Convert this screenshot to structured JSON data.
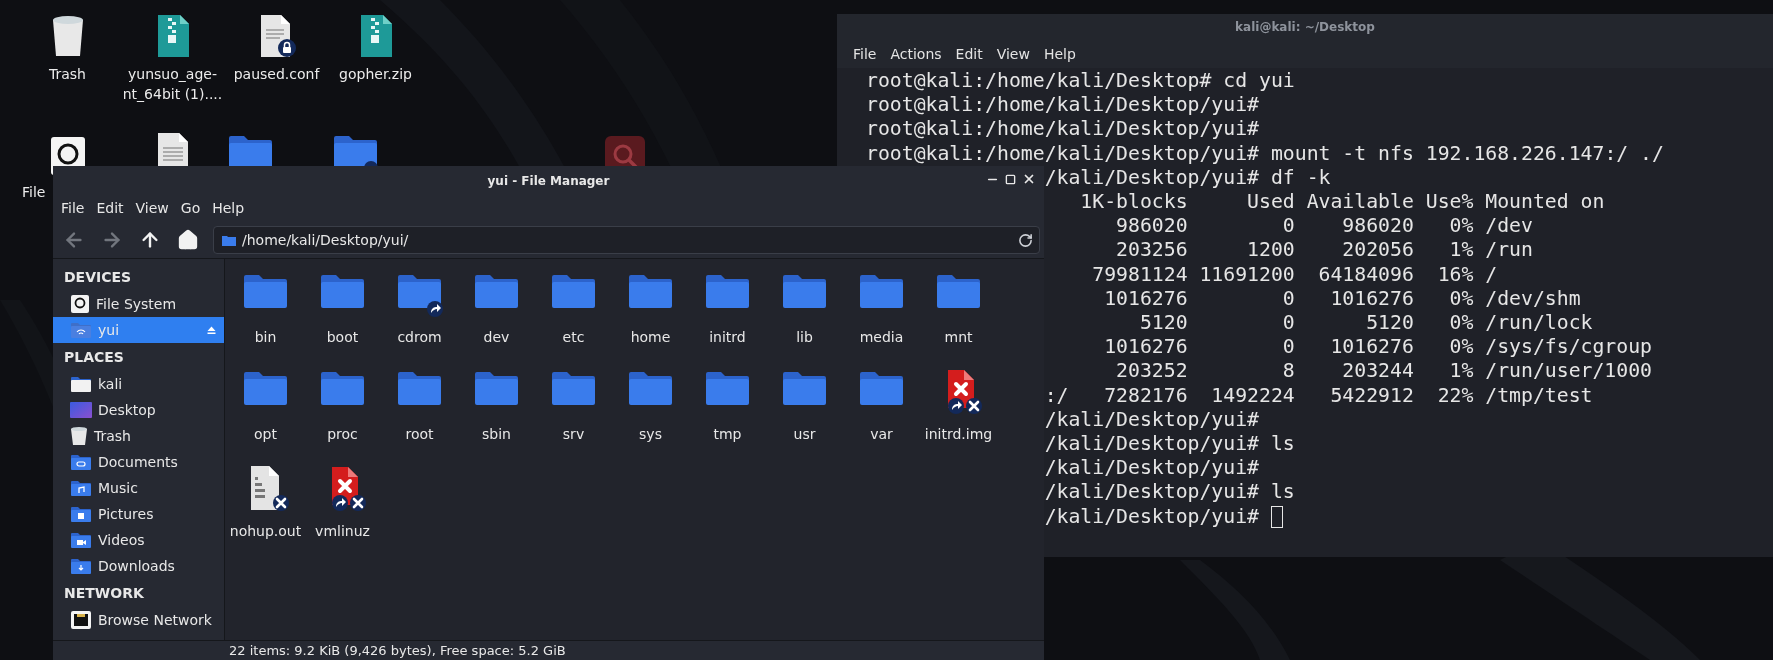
{
  "desktop": {
    "icons": [
      {
        "kind": "trash",
        "label_lines": [
          "Trash"
        ]
      },
      {
        "kind": "archive",
        "label_lines": [
          "yunsuo_age-",
          "nt_64bit (1)...."
        ]
      },
      {
        "kind": "locked-text-file",
        "label_lines": [
          "paused.conf"
        ]
      },
      {
        "kind": "archive",
        "label_lines": [
          "gopher.zip"
        ]
      },
      {
        "kind": "drive",
        "label_lines": [
          "File"
        ]
      },
      {
        "kind": "text-file"
      },
      {
        "kind": "folder"
      },
      {
        "kind": "shared-folder"
      },
      {
        "kind": "search-app"
      }
    ]
  },
  "terminal": {
    "title": "kali@kali: ~/Desktop",
    "menu": [
      "File",
      "Actions",
      "Edit",
      "View",
      "Help"
    ],
    "cursor": true,
    "lines": [
      {
        "text": "root@kali:/home/kali/Desktop# cd yui",
        "clipped": false
      },
      {
        "text": "root@kali:/home/kali/Desktop/yui#",
        "clipped": false
      },
      {
        "text": "root@kali:/home/kali/Desktop/yui#",
        "clipped": false
      },
      {
        "text": "root@kali:/home/kali/Desktop/yui# mount -t nfs 192.168.226.147:/ ./",
        "clipped": false
      },
      {
        "text": "/kali/Desktop/yui# df -k",
        "clipped": true
      },
      {
        "text": "   1K-blocks     Used Available Use% Mounted on",
        "clipped": true
      },
      {
        "text": "      986020        0    986020   0% /dev",
        "clipped": true
      },
      {
        "text": "      203256     1200    202056   1% /run",
        "clipped": true
      },
      {
        "text": "    79981124 11691200  64184096  16% /",
        "clipped": true
      },
      {
        "text": "     1016276        0   1016276   0% /dev/shm",
        "clipped": true
      },
      {
        "text": "        5120        0      5120   0% /run/lock",
        "clipped": true
      },
      {
        "text": "     1016276        0   1016276   0% /sys/fs/cgroup",
        "clipped": true
      },
      {
        "text": "      203252        8    203244   1% /run/user/1000",
        "clipped": true
      },
      {
        "text": ":/   7282176  1492224   5422912  22% /tmp/test",
        "clipped": true
      },
      {
        "text": "/kali/Desktop/yui#",
        "clipped": true
      },
      {
        "text": "/kali/Desktop/yui# ls",
        "clipped": true
      },
      {
        "text": "/kali/Desktop/yui#",
        "clipped": true
      },
      {
        "text": "/kali/Desktop/yui# ls",
        "clipped": true
      },
      {
        "text": "/kali/Desktop/yui# ",
        "clipped": true
      }
    ]
  },
  "file_manager": {
    "title": "yui - File Manager",
    "menu": [
      "File",
      "Edit",
      "View",
      "Go",
      "Help"
    ],
    "toolbar": [
      {
        "kind": "back",
        "disabled": true
      },
      {
        "kind": "forward",
        "disabled": true
      },
      {
        "kind": "up",
        "disabled": false
      },
      {
        "kind": "home",
        "disabled": false
      }
    ],
    "location": "/home/kali/Desktop/yui/",
    "sidebar": [
      {
        "title": "DEVICES",
        "items": [
          {
            "label": "File System",
            "kind": "drive",
            "selected": false,
            "ejectable": false
          },
          {
            "label": "yui",
            "kind": "network-folder",
            "selected": true,
            "ejectable": true
          }
        ]
      },
      {
        "title": "PLACES",
        "items": [
          {
            "label": "kali",
            "kind": "home",
            "selected": false,
            "ejectable": false
          },
          {
            "label": "Desktop",
            "kind": "desktop",
            "selected": false,
            "ejectable": false
          },
          {
            "label": "Trash",
            "kind": "trash",
            "selected": false,
            "ejectable": false
          },
          {
            "label": "Documents",
            "kind": "documents",
            "selected": false,
            "ejectable": false
          },
          {
            "label": "Music",
            "kind": "music",
            "selected": false,
            "ejectable": false
          },
          {
            "label": "Pictures",
            "kind": "pictures",
            "selected": false,
            "ejectable": false
          },
          {
            "label": "Videos",
            "kind": "videos",
            "selected": false,
            "ejectable": false
          },
          {
            "label": "Downloads",
            "kind": "downloads",
            "selected": false,
            "ejectable": false
          }
        ]
      },
      {
        "title": "NETWORK",
        "items": [
          {
            "label": "Browse Network",
            "kind": "network",
            "selected": false,
            "ejectable": false
          }
        ]
      }
    ],
    "items": [
      {
        "name": "bin",
        "kind": "folder",
        "symlink": false,
        "unreadable": false
      },
      {
        "name": "boot",
        "kind": "folder",
        "symlink": false,
        "unreadable": false
      },
      {
        "name": "cdrom",
        "kind": "folder",
        "symlink": true,
        "unreadable": false
      },
      {
        "name": "dev",
        "kind": "folder",
        "symlink": false,
        "unreadable": false
      },
      {
        "name": "etc",
        "kind": "folder",
        "symlink": false,
        "unreadable": false
      },
      {
        "name": "home",
        "kind": "folder",
        "symlink": false,
        "unreadable": false
      },
      {
        "name": "initrd",
        "kind": "folder",
        "symlink": false,
        "unreadable": false
      },
      {
        "name": "lib",
        "kind": "folder",
        "symlink": false,
        "unreadable": false
      },
      {
        "name": "media",
        "kind": "folder",
        "symlink": false,
        "unreadable": false
      },
      {
        "name": "mnt",
        "kind": "folder",
        "symlink": false,
        "unreadable": false
      },
      {
        "name": "opt",
        "kind": "folder",
        "symlink": false,
        "unreadable": false
      },
      {
        "name": "proc",
        "kind": "folder",
        "symlink": false,
        "unreadable": false
      },
      {
        "name": "root",
        "kind": "folder",
        "symlink": false,
        "unreadable": false
      },
      {
        "name": "sbin",
        "kind": "folder",
        "symlink": false,
        "unreadable": false
      },
      {
        "name": "srv",
        "kind": "folder",
        "symlink": false,
        "unreadable": false
      },
      {
        "name": "sys",
        "kind": "folder",
        "symlink": false,
        "unreadable": false
      },
      {
        "name": "tmp",
        "kind": "folder",
        "symlink": false,
        "unreadable": false
      },
      {
        "name": "usr",
        "kind": "folder",
        "symlink": false,
        "unreadable": false
      },
      {
        "name": "var",
        "kind": "folder",
        "symlink": false,
        "unreadable": false
      },
      {
        "name": "initrd.img",
        "kind": "broken-file",
        "symlink": true,
        "unreadable": true
      },
      {
        "name": "nohup.out",
        "kind": "binary-file",
        "symlink": false,
        "unreadable": true
      },
      {
        "name": "vmlinuz",
        "kind": "broken-file",
        "symlink": true,
        "unreadable": true
      }
    ],
    "status": "22 items: 9.2 KiB (9,426 bytes), Free space: 5.2 GiB"
  }
}
